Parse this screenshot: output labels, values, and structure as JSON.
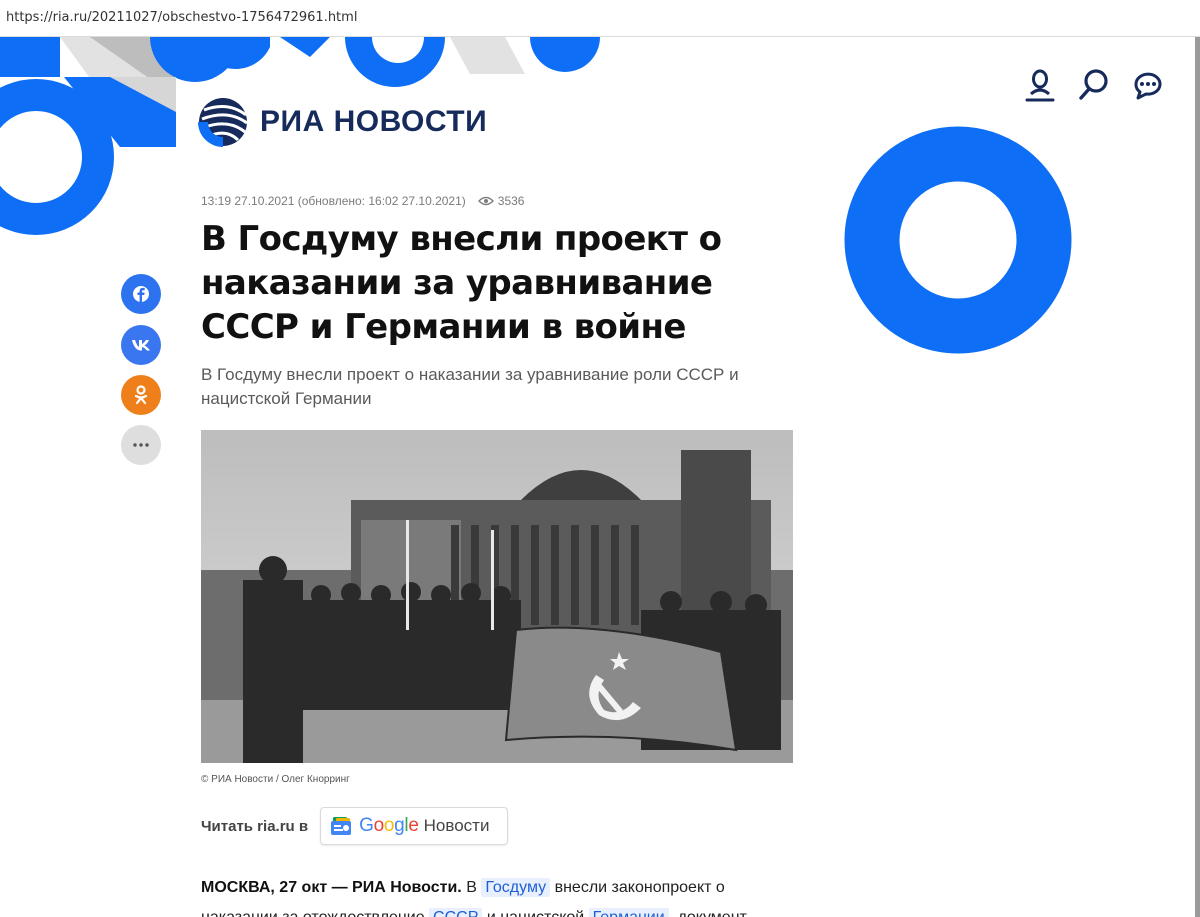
{
  "browser": {
    "url": "https://ria.ru/20211027/obschestvo-1756472961.html"
  },
  "brand": {
    "logo_text": "РИА НОВОСТИ",
    "color": "#162b5b",
    "accent": "#0e6ef5"
  },
  "header_icons": [
    "user-icon",
    "search-icon",
    "chat-icon"
  ],
  "article": {
    "published": "13:19 27.10.2021 (обновлено: 16:02 27.10.2021)",
    "views": "3536",
    "title": "В Госдуму внесли проект о наказании за уравнивание СССР и Германии в войне",
    "subtitle": "В Госдуму внесли проект о наказании за уравнивание роли СССР и нацистской Германии",
    "photo_caption": "© РИА Новости / Олег Кнорринг",
    "read_label": "Читать ria.ru в",
    "google_news": {
      "google": "Google",
      "label": "Новости"
    },
    "lead": {
      "dateline": "МОСКВА, 27 окт — РИА Новости.",
      "t1": " В ",
      "link1": "Госдуму",
      "t2": " внесли законопроект о наказании за отождествление ",
      "link2": "СССР",
      "t3": " и нацистской ",
      "link3": "Германии",
      "t4": ", документ"
    }
  },
  "share": [
    "facebook-icon",
    "vk-icon",
    "odnoklassniki-icon",
    "more-icon"
  ]
}
